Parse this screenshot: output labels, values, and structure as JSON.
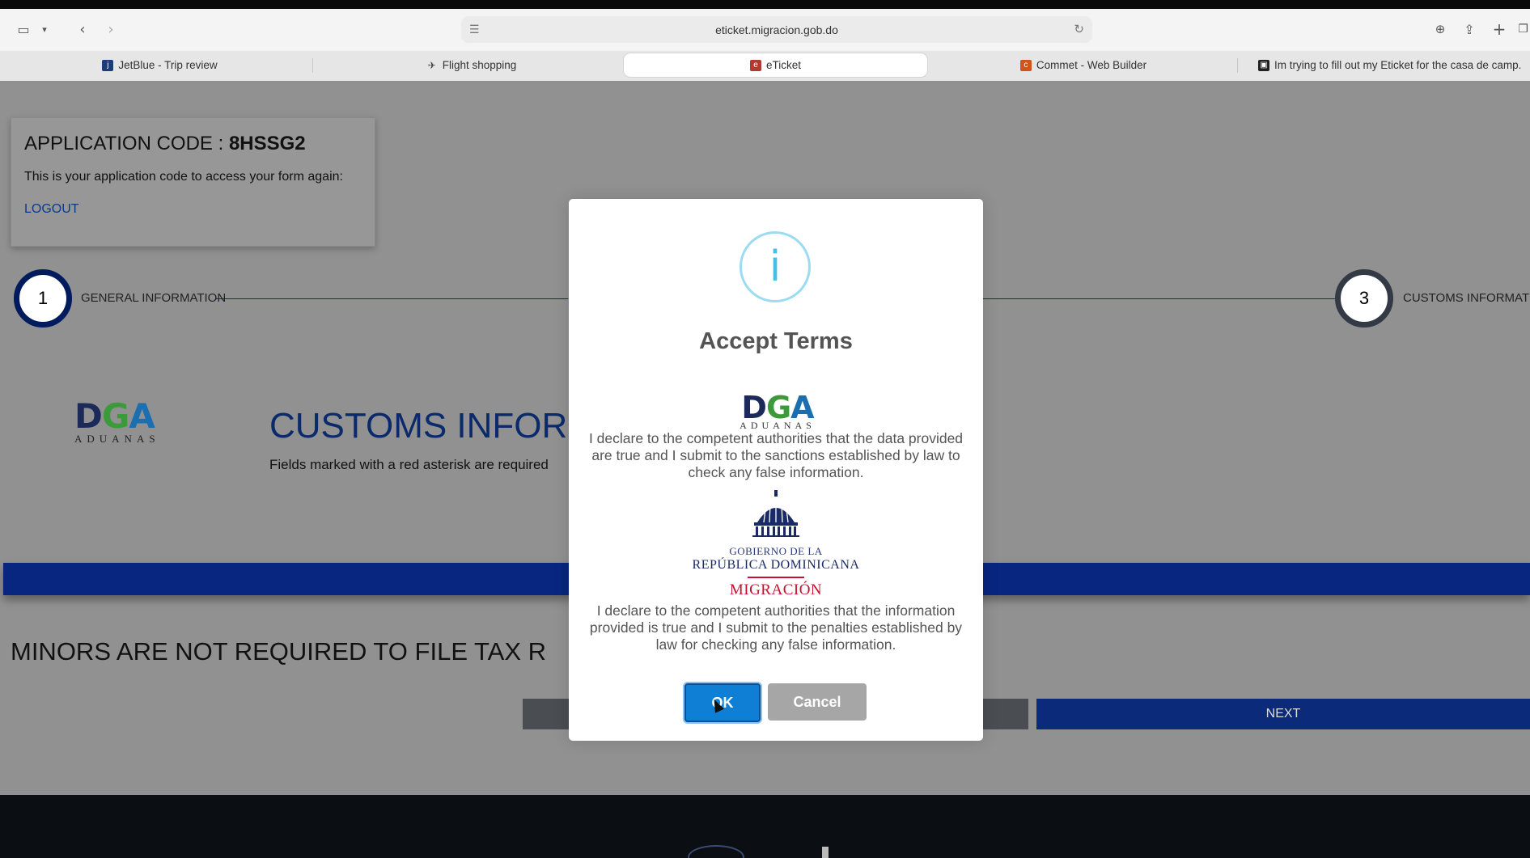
{
  "browser": {
    "url": "eticket.migracion.gob.do",
    "tabs": [
      {
        "label": "JetBlue - Trip review",
        "icon": "jetblue-favicon"
      },
      {
        "label": "Flight shopping",
        "icon": "airplane-icon"
      },
      {
        "label": "eTicket",
        "icon": "eticket-favicon",
        "active": true
      },
      {
        "label": "Commet - Web Builder",
        "icon": "commet-favicon"
      },
      {
        "label": "Im trying to fill out my Eticket for the casa de camp.",
        "icon": "document-favicon"
      }
    ]
  },
  "application": {
    "code_label": "APPLICATION CODE : ",
    "code_value": "8HSSG2",
    "description": "This is your application code to access your form again:",
    "logout_label": "LOGOUT"
  },
  "stepper": {
    "step1_number": "1",
    "step1_label": "GENERAL INFORMATION",
    "step3_number": "3",
    "step3_label": "CUSTOMS INFORMATIO"
  },
  "customs": {
    "logo_mark": "DGA",
    "logo_sub": "ADUANAS",
    "title": "CUSTOMS INFORM",
    "subtitle": "Fields marked with a red asterisk are required"
  },
  "minors_text": "MINORS ARE NOT REQUIRED TO FILE TAX R",
  "next_label": "NEXT",
  "modal": {
    "icon_glyph": "i",
    "title": "Accept Terms",
    "dga_mark": "DGA",
    "dga_sub": "ADUANAS",
    "text1": "I declare to the competent authorities that the data provided are true and I submit to the sanctions established by law to check any false information.",
    "gov_line1": "GOBIERNO DE LA",
    "gov_line2": "REPÚBLICA DOMINICANA",
    "gov_line3": "MIGRACIÓN",
    "text2": "I declare to the competent authorities that the information provided is true and I submit to the penalties established by law for checking any false information.",
    "ok_label": "OK",
    "cancel_label": "Cancel"
  },
  "colors": {
    "navy": "#0b2a6b",
    "ok_blue": "#0e7fd4",
    "info_blue": "#3fc1ea",
    "migracion_red": "#c8102e",
    "overlay_gray": "#919191"
  }
}
